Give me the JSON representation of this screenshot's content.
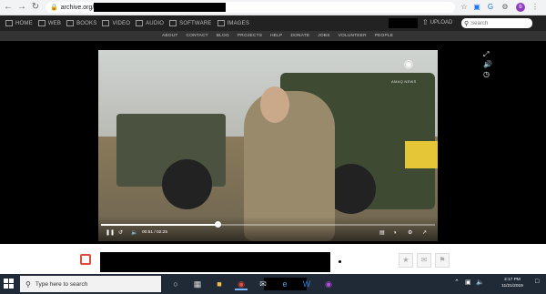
{
  "browser": {
    "url": "archive.org/"
  },
  "topnav": {
    "items": [
      {
        "label": "HOME",
        "icon": "home-icon"
      },
      {
        "label": "WEB",
        "icon": "web-icon"
      },
      {
        "label": "BOOKS",
        "icon": "books-icon"
      },
      {
        "label": "VIDEO",
        "icon": "video-icon"
      },
      {
        "label": "AUDIO",
        "icon": "audio-icon"
      },
      {
        "label": "SOFTWARE",
        "icon": "software-icon"
      },
      {
        "label": "IMAGES",
        "icon": "images-icon"
      }
    ],
    "upload_label": "UPLOAD",
    "search_placeholder": "Search"
  },
  "subnav": {
    "items": [
      "ABOUT",
      "CONTACT",
      "BLOG",
      "PROJECTS",
      "HELP",
      "DONATE",
      "JOBS",
      "VOLUNTEER",
      "PEOPLE"
    ]
  },
  "video": {
    "watermark_text": "AMAQ NEWS",
    "current_time": "00:51",
    "duration": "02:25",
    "progress_fraction": 0.35
  },
  "taskbar": {
    "search_placeholder": "Type here to search",
    "time": "2:17 PM",
    "date": "11/21/2019"
  }
}
